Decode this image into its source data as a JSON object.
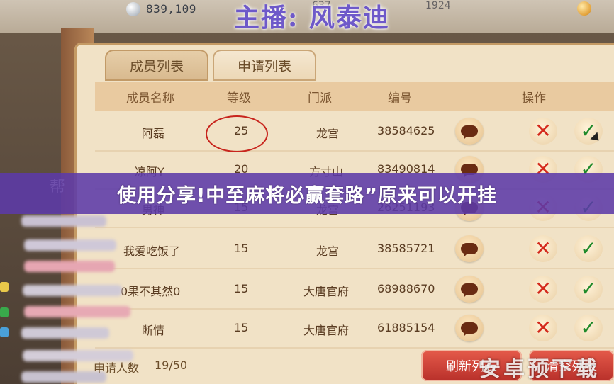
{
  "topbar": {
    "coin_value": "839,109",
    "host_title": "主播: 风泰迪",
    "bg_num_left": "637",
    "bg_num_right": "1924"
  },
  "tabs": [
    {
      "label": "成员列表",
      "active": false
    },
    {
      "label": "申请列表",
      "active": true
    }
  ],
  "table": {
    "headers": [
      "成员名称",
      "等级",
      "门派",
      "编号",
      "操作"
    ],
    "rows": [
      {
        "name": "阿磊",
        "level": "25",
        "sect": "龙宫",
        "id": "38584625"
      },
      {
        "name": "凉阿Y",
        "level": "20",
        "sect": "方寸山",
        "id": "83490814"
      },
      {
        "name": "男神",
        "level": "15",
        "sect": "龙宫",
        "id": "26251193"
      },
      {
        "name": "我爱吃饭了",
        "level": "15",
        "sect": "龙宫",
        "id": "38585721"
      },
      {
        "name": "0果不其然0",
        "level": "15",
        "sect": "大唐官府",
        "id": "68988670"
      },
      {
        "name": "断情",
        "level": "15",
        "sect": "大唐官府",
        "id": "61885154"
      }
    ]
  },
  "footer": {
    "apply_count_label": "申请人数",
    "apply_count_value": "19/50",
    "refresh_button": "刷新列表",
    "clear_button": "清空列表"
  },
  "side": {
    "deco_char": "帮"
  },
  "overlay": {
    "text": "使用分享!中至麻将必赢套路”原来可以开挂"
  },
  "watermark": {
    "text": "安卓预下载"
  },
  "colors": {
    "overlay_bg": "#5c3aa8",
    "reject": "#d42a1d",
    "accept": "#1f8a2a",
    "panel": "#f1e2c6"
  }
}
